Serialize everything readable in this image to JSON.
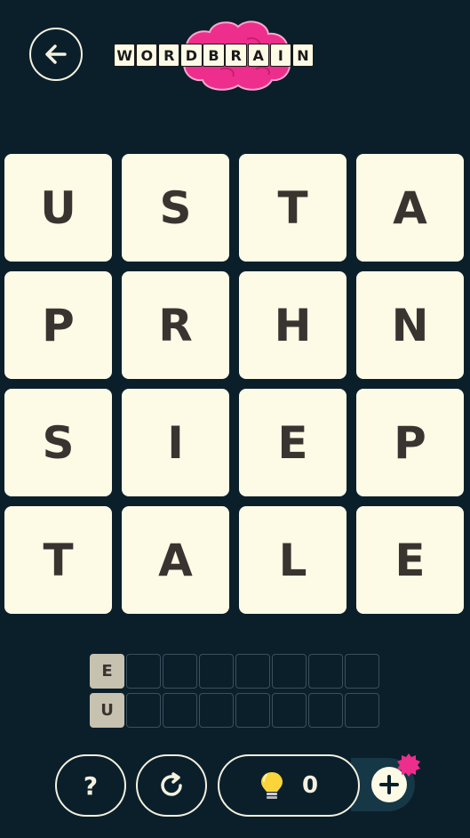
{
  "header": {
    "back_icon": "arrow-left-icon",
    "logo_letters": [
      "W",
      "O",
      "R",
      "D",
      "B",
      "R",
      "A",
      "I",
      "N"
    ]
  },
  "board": {
    "tiles": [
      "U",
      "S",
      "T",
      "A",
      "P",
      "R",
      "H",
      "N",
      "S",
      "I",
      "E",
      "P",
      "T",
      "A",
      "L",
      "E"
    ]
  },
  "answers": {
    "row1_hint": "E",
    "row2_hint": "U"
  },
  "footer": {
    "help_label": "?",
    "restart_icon": "restart-icon",
    "hint_icon": "lightbulb-icon",
    "hint_count": "0",
    "add_icon": "plus-icon"
  },
  "colors": {
    "background": "#0b1f2b",
    "tile": "#fdfbe6",
    "letter": "#3a3431",
    "brand_pink": "#ee2e8c"
  }
}
